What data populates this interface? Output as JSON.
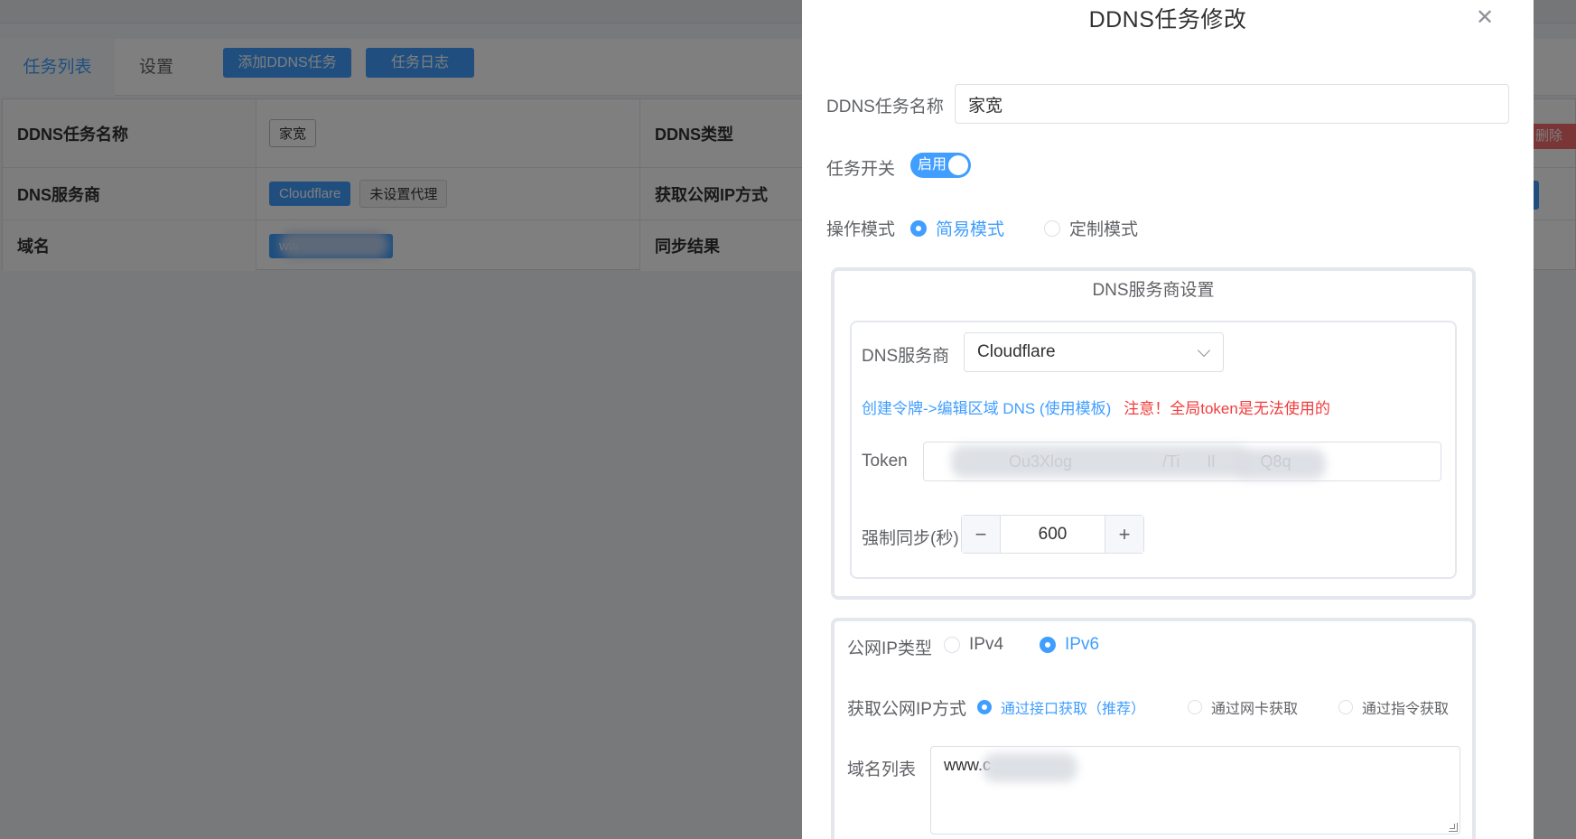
{
  "nav": {
    "tabs": [
      {
        "label": "任务列表",
        "active": true
      },
      {
        "label": "设置",
        "active": false
      }
    ],
    "add_button": "添加DDNS任务",
    "log_button": "任务日志"
  },
  "detail": {
    "rows": [
      {
        "label": "DDNS任务名称",
        "tags": [
          "家宽"
        ],
        "label2": "DDNS类型"
      },
      {
        "label": "DNS服务商",
        "tags": [
          "Cloudflare",
          "未设置代理"
        ],
        "label2": "获取公网IP方式"
      },
      {
        "label": "域名",
        "tags": [
          "ww"
        ],
        "label2": "同步结果"
      }
    ],
    "delete_button": "删除"
  },
  "drawer": {
    "title": "DDNS任务修改",
    "close_icon": "close-icon",
    "task_name": {
      "label": "DDNS任务名称",
      "value": "家宽"
    },
    "task_switch": {
      "label": "任务开关",
      "text": "启用",
      "on": true
    },
    "mode": {
      "label": "操作模式",
      "options": [
        "简易模式",
        "定制模式"
      ],
      "selected": "简易模式"
    },
    "dns_settings": {
      "title": "DNS服务商设置",
      "provider_label": "DNS服务商",
      "provider_value": "Cloudflare",
      "help_link": "创建令牌->编辑区域 DNS (使用模板)",
      "warning": "注意！全局token是无法使用的",
      "token_label": "Token",
      "token_value": "                Ou3Xlog                    /Ti      Il          Q8q",
      "sync_label": "强制同步(秒)",
      "sync_value": "600"
    },
    "ip_settings": {
      "ip_type_label": "公网IP类型",
      "ip_type_options": [
        "IPv4",
        "IPv6"
      ],
      "ip_type_selected": "IPv6",
      "method_label": "获取公网IP方式",
      "method_options": [
        "通过接口获取（推荐）",
        "通过网卡获取",
        "通过指令获取"
      ],
      "method_selected": "通过接口获取（推荐）",
      "domain_list_label": "域名列表",
      "domain_list_value": "www.c"
    }
  },
  "colors": {
    "primary": "#409eff",
    "danger": "#f56c6c",
    "warning_text": "#f23c3c"
  }
}
